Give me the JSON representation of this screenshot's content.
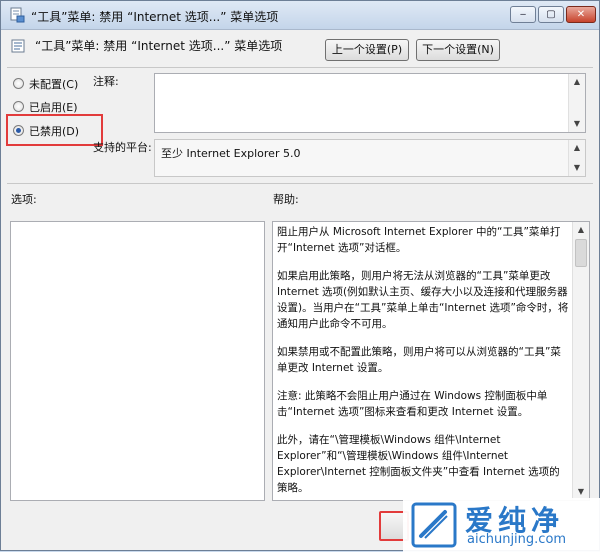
{
  "window": {
    "title": "“工具”菜单: 禁用 “Internet 选项...” 菜单选项",
    "controls": {
      "minimize": "‒",
      "maximize": "▢",
      "close": "✕"
    }
  },
  "header": {
    "policy_title": "“工具”菜单: 禁用 “Internet 选项...” 菜单选项",
    "prev_button": "上一个设置(P)",
    "next_button": "下一个设置(N)"
  },
  "state": {
    "options": [
      {
        "label": "未配置(C)",
        "checked": false
      },
      {
        "label": "已启用(E)",
        "checked": false
      },
      {
        "label": "已禁用(D)",
        "checked": true
      }
    ]
  },
  "comment": {
    "label": "注释:",
    "value": ""
  },
  "supported": {
    "label": "支持的平台:",
    "value": "至少 Internet Explorer 5.0"
  },
  "options_section": {
    "label": "选项:"
  },
  "help_section": {
    "label": "帮助:",
    "paragraphs": [
      "阻止用户从 Microsoft Internet Explorer 中的“工具”菜单打开“Internet 选项”对话框。",
      "如果启用此策略，则用户将无法从浏览器的“工具”菜单更改 Internet 选项(例如默认主页、缓存大小以及连接和代理服务器设置)。当用户在“工具”菜单上单击“Internet 选项”命令时，将通知用户此命令不可用。",
      "如果禁用或不配置此策略，则用户将可以从浏览器的“工具”菜单更改 Internet 设置。",
      "注意: 此策略不会阻止用户通过在 Windows 控制面板中单击“Internet 选项”图标来查看和更改 Internet 设置。",
      "此外，请在“\\管理模板\\Windows 组件\\Internet Explorer”和“\\管理模板\\Windows 组件\\Internet Explorer\\Internet 控制面板文件夹”中查看 Internet 选项的策略。"
    ]
  },
  "watermark": {
    "cn": "爱纯净",
    "url": "aichunjing.com"
  },
  "colors": {
    "highlight": "#e23b3b",
    "watermark": "#2a78c8"
  }
}
